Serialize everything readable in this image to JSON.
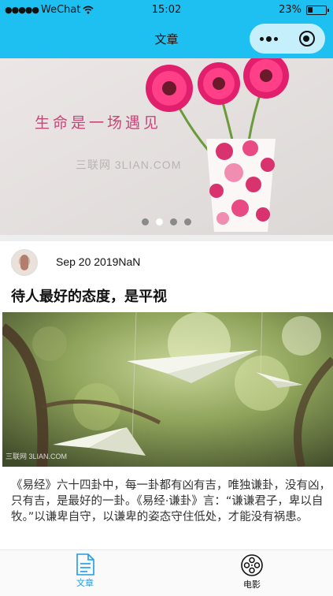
{
  "status_bar": {
    "carrier": "WeChat",
    "time": "15:02",
    "battery": "23%"
  },
  "nav_bar": {
    "title": "文章"
  },
  "banner": {
    "caption": "生命是一场遇见",
    "watermark": "三联网 3LIAN.COM",
    "slide_count": 4,
    "active_slide": 2
  },
  "post": {
    "date": "Sep 20 2019NaN",
    "title": "待人最好的态度，是平视",
    "image_watermark": "三联网 3LIAN.COM",
    "body": "《易经》六十四卦中，每一卦都有凶有吉，唯独谦卦，没有凶，只有吉，是最好的一卦。《易经·谦卦》言：“谦谦君子，卑以自牧。”以谦卑自守，以谦卑的姿态守住低处，才能没有祸患。"
  },
  "tab_bar": {
    "items": [
      {
        "label": "文章",
        "icon": "document-icon",
        "active": true
      },
      {
        "label": "电影",
        "icon": "film-reel-icon",
        "active": false
      }
    ]
  },
  "colors": {
    "header_bg": "#1ec0f2",
    "tab_active": "#1e9be8"
  }
}
